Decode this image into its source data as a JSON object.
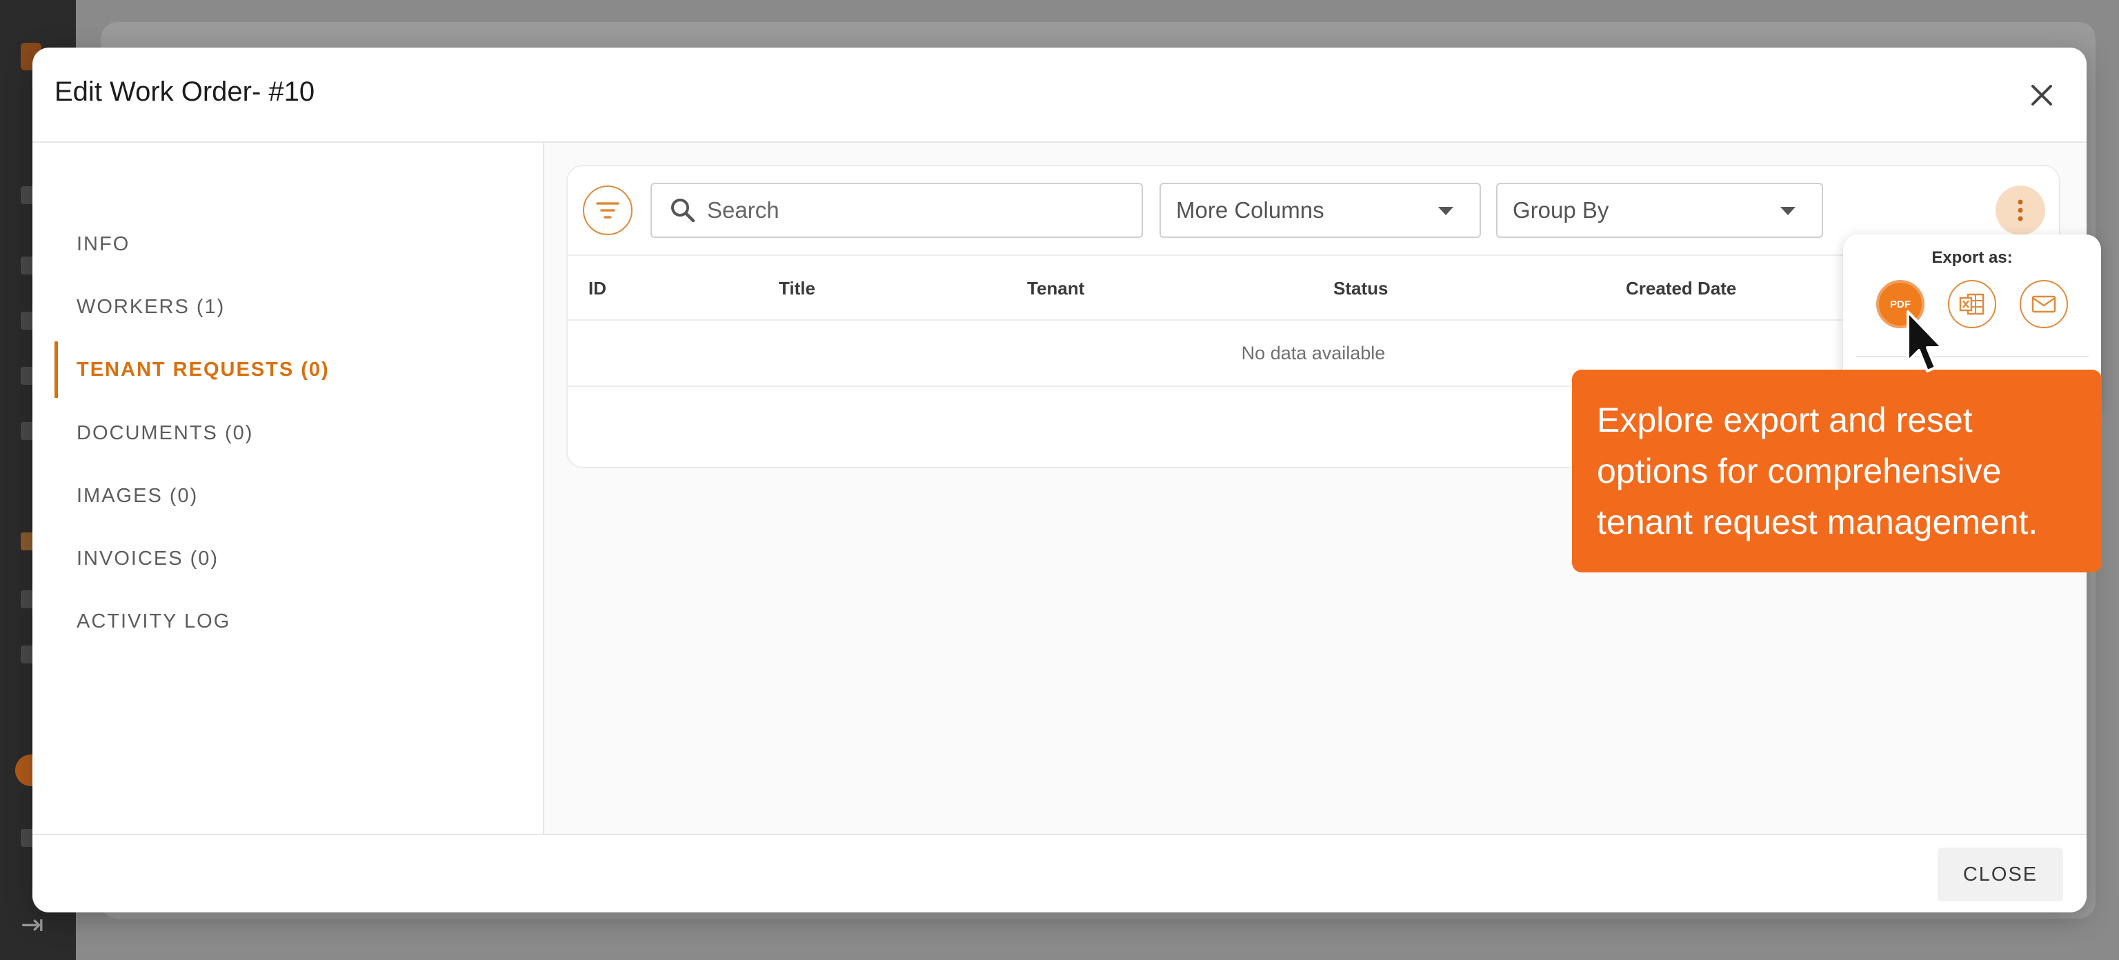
{
  "modal": {
    "title": "Edit Work Order- #10",
    "close_label": "CLOSE"
  },
  "tabs": [
    {
      "label": "INFO",
      "active": false
    },
    {
      "label": "WORKERS (1)",
      "active": false
    },
    {
      "label": "TENANT REQUESTS (0)",
      "active": true
    },
    {
      "label": "DOCUMENTS (0)",
      "active": false
    },
    {
      "label": "IMAGES (0)",
      "active": false
    },
    {
      "label": "INVOICES (0)",
      "active": false
    },
    {
      "label": "ACTIVITY LOG",
      "active": false
    }
  ],
  "toolbar": {
    "search_placeholder": "Search",
    "more_columns": "More Columns",
    "group_by": "Group By"
  },
  "table": {
    "columns": [
      "ID",
      "Title",
      "Tenant",
      "Status",
      "Created Date"
    ],
    "empty_text": "No data available"
  },
  "export": {
    "label": "Export as:",
    "pdf_icon_text": "PDF",
    "options": [
      "pdf-icon",
      "excel-icon",
      "email-icon"
    ]
  },
  "tooltip": {
    "text": "Explore export and reset options for comprehensive tenant request management."
  },
  "colors": {
    "accent": "#d9700f",
    "tooltip_bg": "#f26b1d",
    "overlay": "#8a8a8a"
  }
}
